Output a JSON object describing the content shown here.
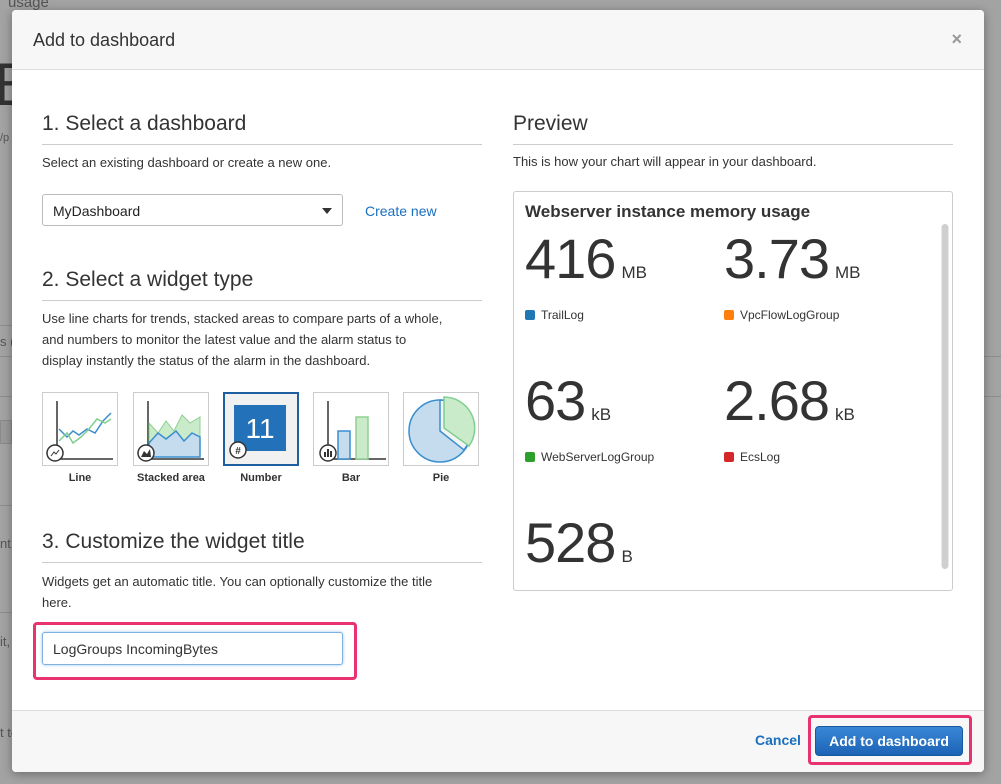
{
  "background": {
    "fragments": [
      "usage",
      "B",
      "/p",
      "s (",
      "nt,",
      "it,",
      "t to"
    ]
  },
  "modal": {
    "title": "Add to dashboard",
    "close_glyph": "×"
  },
  "section1": {
    "heading": "1. Select a dashboard",
    "description": "Select an existing dashboard or create a new one.",
    "dashboard_select_value": "MyDashboard",
    "create_new_label": "Create new"
  },
  "section2": {
    "heading": "2. Select a widget type",
    "description_lines": [
      "Use line charts for trends, stacked areas to compare parts of a whole,",
      "and numbers to monitor the latest value and the alarm status to",
      "display instantly the status of the alarm in the dashboard."
    ],
    "widgets": [
      {
        "label": "Line",
        "icon": "line-chart-icon",
        "selected": false
      },
      {
        "label": "Stacked area",
        "icon": "stacked-area-icon",
        "selected": false
      },
      {
        "label": "Number",
        "icon": "number-icon",
        "selected": true,
        "glyph": "11"
      },
      {
        "label": "Bar",
        "icon": "bar-chart-icon",
        "selected": false
      },
      {
        "label": "Pie",
        "icon": "pie-chart-icon",
        "selected": false
      }
    ]
  },
  "section3": {
    "heading": "3. Customize the widget title",
    "description_lines": [
      "Widgets get an automatic title. You can optionally customize the title",
      "here."
    ],
    "title_value": "LogGroups IncomingBytes"
  },
  "preview": {
    "heading": "Preview",
    "description": "This is how your chart will appear in your dashboard.",
    "chart_title": "Webserver instance memory usage",
    "metrics": [
      {
        "value": "416",
        "unit": "MB",
        "label": "TrailLog",
        "color": "#1f77b4"
      },
      {
        "value": "3.73",
        "unit": "MB",
        "label": "VpcFlowLogGroup",
        "color": "#ff7f0e"
      },
      {
        "value": "63",
        "unit": "kB",
        "label": "WebServerLogGroup",
        "color": "#2ca02c"
      },
      {
        "value": "2.68",
        "unit": "kB",
        "label": "EcsLog",
        "color": "#d62728"
      },
      {
        "value": "528",
        "unit": "B"
      }
    ]
  },
  "footer": {
    "cancel_label": "Cancel",
    "add_label": "Add to dashboard"
  }
}
